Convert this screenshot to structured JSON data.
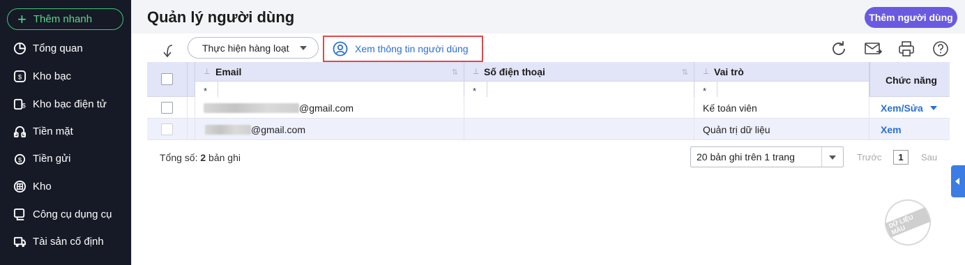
{
  "sidebar": {
    "quick_add_label": "Thêm nhanh",
    "items": [
      {
        "label": "Tổng quan",
        "icon": "pie-chart-icon"
      },
      {
        "label": "Kho bạc",
        "icon": "treasury-icon"
      },
      {
        "label": "Kho bạc điện tử",
        "icon": "e-treasury-icon"
      },
      {
        "label": "Tiền mặt",
        "icon": "cash-icon"
      },
      {
        "label": "Tiền gửi",
        "icon": "deposit-icon"
      },
      {
        "label": "Kho",
        "icon": "warehouse-icon"
      },
      {
        "label": "Công cụ dụng cụ",
        "icon": "tools-icon"
      },
      {
        "label": "Tài sản cố định",
        "icon": "fixed-asset-icon"
      }
    ]
  },
  "header": {
    "title": "Quản lý người dùng",
    "add_user_label": "Thêm người dùng"
  },
  "toolbar": {
    "bulk_action_label": "Thực hiện hàng loạt",
    "view_info_label": "Xem thông tin người dùng",
    "icons": [
      "refresh-icon",
      "mail-icon",
      "print-icon",
      "help-icon"
    ]
  },
  "table": {
    "columns": {
      "email": "Email",
      "phone": "Số điện thoại",
      "role": "Vai trò",
      "actions": "Chức năng"
    },
    "filter_placeholder": "*",
    "rows": [
      {
        "email_suffix": "@gmail.com",
        "phone": "",
        "role": "Kế toán viên",
        "action": "Xem/Sửa",
        "has_dropdown": true
      },
      {
        "email_suffix": "@gmail.com",
        "phone": "",
        "role": "Quản trị dữ liệu",
        "action": "Xem",
        "has_dropdown": false
      }
    ]
  },
  "footer": {
    "total_prefix": "Tổng số: ",
    "total_count": "2",
    "total_suffix": " bản ghi",
    "per_page": "20 bản ghi trên 1 trang",
    "prev_label": "Trước",
    "current_page": "1",
    "next_label": "Sau"
  },
  "watermark": "DỮ LIỆU MẪU",
  "colors": {
    "sidebar_bg": "#161a26",
    "quick_add_green": "#57d98c",
    "primary_purple": "#6a5ae0",
    "link_blue": "#2a6fd6",
    "highlight_red": "#e04848",
    "header_row_bg": "#e2e4f8"
  }
}
